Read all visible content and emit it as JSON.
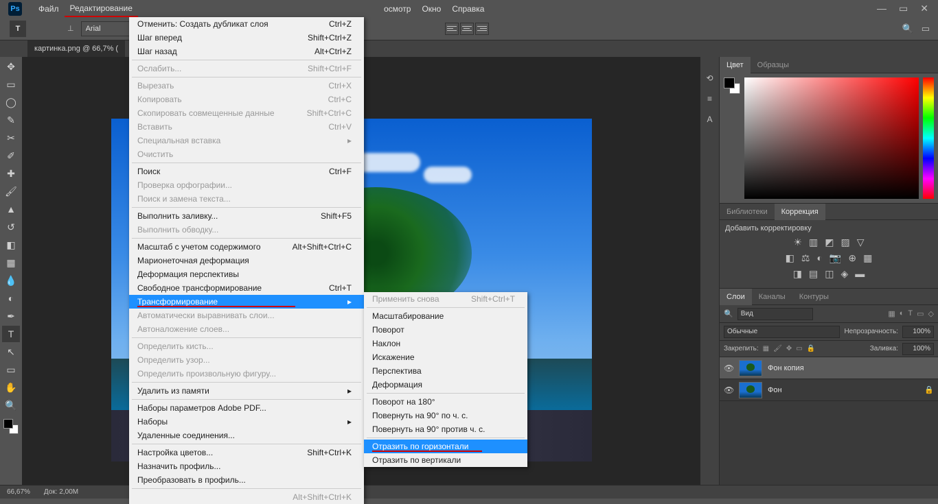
{
  "menubar": {
    "logo": "Ps",
    "items": [
      "Файл",
      "Редактирование",
      "",
      "",
      "",
      "",
      "",
      "",
      "",
      "",
      "осмотр",
      "Окно",
      "Справка"
    ]
  },
  "options": {
    "font": "Arial"
  },
  "doc_tab": "картинка.png @ 66,7% (",
  "edit_menu": [
    {
      "label": "Отменить: Создать дубликат слоя",
      "shortcut": "Ctrl+Z"
    },
    {
      "label": "Шаг вперед",
      "shortcut": "Shift+Ctrl+Z"
    },
    {
      "label": "Шаг назад",
      "shortcut": "Alt+Ctrl+Z"
    },
    {
      "sep": true
    },
    {
      "label": "Ослабить...",
      "shortcut": "Shift+Ctrl+F",
      "disabled": true
    },
    {
      "sep": true
    },
    {
      "label": "Вырезать",
      "shortcut": "Ctrl+X",
      "disabled": true
    },
    {
      "label": "Копировать",
      "shortcut": "Ctrl+C",
      "disabled": true
    },
    {
      "label": "Скопировать совмещенные данные",
      "shortcut": "Shift+Ctrl+C",
      "disabled": true
    },
    {
      "label": "Вставить",
      "shortcut": "Ctrl+V",
      "disabled": true
    },
    {
      "label": "Специальная вставка",
      "arrow": true,
      "disabled": true
    },
    {
      "label": "Очистить",
      "disabled": true
    },
    {
      "sep": true
    },
    {
      "label": "Поиск",
      "shortcut": "Ctrl+F"
    },
    {
      "label": "Проверка орфографии...",
      "disabled": true
    },
    {
      "label": "Поиск и замена текста...",
      "disabled": true
    },
    {
      "sep": true
    },
    {
      "label": "Выполнить заливку...",
      "shortcut": "Shift+F5"
    },
    {
      "label": "Выполнить обводку...",
      "disabled": true
    },
    {
      "sep": true
    },
    {
      "label": "Масштаб с учетом содержимого",
      "shortcut": "Alt+Shift+Ctrl+C"
    },
    {
      "label": "Марионеточная деформация"
    },
    {
      "label": "Деформация перспективы"
    },
    {
      "label": "Свободное трансформирование",
      "shortcut": "Ctrl+T"
    },
    {
      "label": "Трансформирование",
      "arrow": true,
      "selected": true,
      "underline": true
    },
    {
      "label": "Автоматически выравнивать слои...",
      "disabled": true
    },
    {
      "label": "Автоналожение слоев...",
      "disabled": true
    },
    {
      "sep": true
    },
    {
      "label": "Определить кисть...",
      "disabled": true
    },
    {
      "label": "Определить узор...",
      "disabled": true
    },
    {
      "label": "Определить произвольную фигуру...",
      "disabled": true
    },
    {
      "sep": true
    },
    {
      "label": "Удалить из памяти",
      "arrow": true
    },
    {
      "sep": true
    },
    {
      "label": "Наборы параметров Adobe PDF..."
    },
    {
      "label": "Наборы",
      "arrow": true
    },
    {
      "label": "Удаленные соединения..."
    },
    {
      "sep": true
    },
    {
      "label": "Настройка цветов...",
      "shortcut": "Shift+Ctrl+K"
    },
    {
      "label": "Назначить профиль..."
    },
    {
      "label": "Преобразовать в профиль..."
    },
    {
      "sep": true
    },
    {
      "label": "",
      "shortcut": "Alt+Shift+Ctrl+K",
      "disabled": true
    }
  ],
  "transform_menu": [
    {
      "label": "Применить снова",
      "shortcut": "Shift+Ctrl+T",
      "disabled": true
    },
    {
      "sep": true
    },
    {
      "label": "Масштабирование"
    },
    {
      "label": "Поворот"
    },
    {
      "label": "Наклон"
    },
    {
      "label": "Искажение"
    },
    {
      "label": "Перспектива"
    },
    {
      "label": "Деформация"
    },
    {
      "sep": true
    },
    {
      "label": "Поворот на 180°"
    },
    {
      "label": "Повернуть на 90° по ч. с."
    },
    {
      "label": "Повернуть на 90° против ч. с."
    },
    {
      "sep": true
    },
    {
      "label": "Отразить по горизонтали",
      "selected": true,
      "underline": true
    },
    {
      "label": "Отразить по вертикали"
    }
  ],
  "panels": {
    "color_tab": "Цвет",
    "swatches_tab": "Образцы",
    "libs_tab": "Библиотеки",
    "corrections_tab": "Коррекция",
    "corrections_label": "Добавить корректировку",
    "layers_tab": "Слои",
    "channels_tab": "Каналы",
    "paths_tab": "Контуры"
  },
  "layers": {
    "kind": "Вид",
    "blend": "Обычные",
    "opacity_label": "Непрозрачность:",
    "opacity": "100%",
    "lock_label": "Закрепить:",
    "fill_label": "Заливка:",
    "fill": "100%",
    "rows": [
      {
        "name": "Фон копия",
        "selected": true
      },
      {
        "name": "Фон",
        "locked": true
      }
    ]
  },
  "status": {
    "zoom": "66,67%",
    "doc": "Док: 2,00M"
  }
}
